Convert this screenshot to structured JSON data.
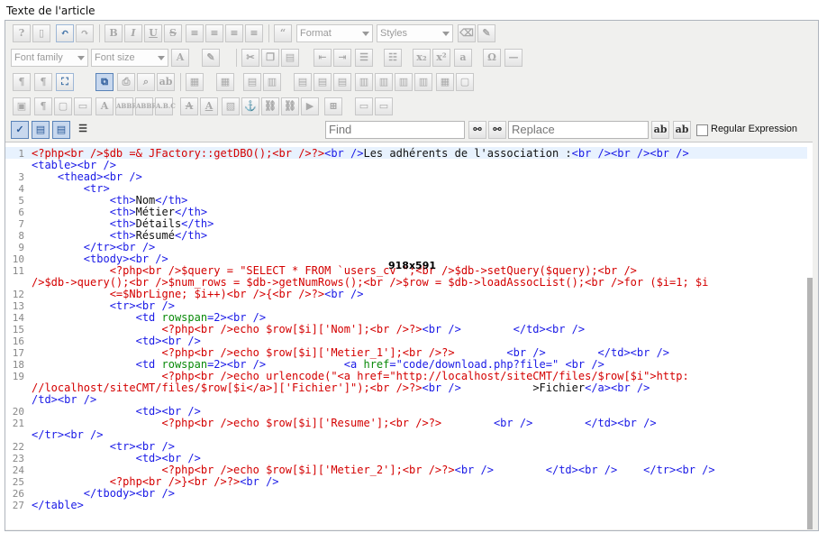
{
  "editor": {
    "title": "Texte de l'article",
    "combos": {
      "format": "Format",
      "styles": "Styles",
      "font_family": "Font family",
      "font_size": "Font size"
    },
    "find_placeholder": "Find",
    "replace_placeholder": "Replace",
    "regex_label": "Regular Expression",
    "dimension_overlay": "918x591"
  },
  "code_lines": [
    {
      "n": "1",
      "segs": [
        [
          "r",
          "<?php<br />$db =& JFactory::getDBO();<br />?>"
        ],
        [
          "b",
          "<br />"
        ],
        [
          "k",
          "Les adhérents de l'association :"
        ],
        [
          "b",
          "<br /><br /><br />"
        ]
      ]
    },
    {
      "n": "",
      "segs": [
        [
          "b",
          "<table><br />"
        ]
      ]
    },
    {
      "n": "3",
      "segs": [
        [
          "b",
          "    <thead><br />"
        ]
      ]
    },
    {
      "n": "4",
      "segs": [
        [
          "b",
          "        <tr>"
        ]
      ]
    },
    {
      "n": "5",
      "segs": [
        [
          "b",
          "            <th>"
        ],
        [
          "k",
          "Nom"
        ],
        [
          "b",
          "</th>"
        ]
      ]
    },
    {
      "n": "6",
      "segs": [
        [
          "b",
          "            <th>"
        ],
        [
          "k",
          "Métier"
        ],
        [
          "b",
          "</th>"
        ]
      ]
    },
    {
      "n": "7",
      "segs": [
        [
          "b",
          "            <th>"
        ],
        [
          "k",
          "Détails"
        ],
        [
          "b",
          "</th>"
        ]
      ]
    },
    {
      "n": "8",
      "segs": [
        [
          "b",
          "            <th>"
        ],
        [
          "k",
          "Résumé"
        ],
        [
          "b",
          "</th>"
        ]
      ]
    },
    {
      "n": "9",
      "segs": [
        [
          "b",
          "        </tr><br />"
        ]
      ]
    },
    {
      "n": "10",
      "segs": [
        [
          "b",
          "        <tbody><br />"
        ]
      ]
    },
    {
      "n": "11",
      "segs": [
        [
          "r",
          "            <?php<br />$query = \"SELECT * FROM `users_cv`\";<br />$db->setQuery($query);<br />"
        ]
      ]
    },
    {
      "n": "",
      "segs": [
        [
          "r",
          "/>$db->query();<br />$num_rows = $db->getNumRows();<br />$row = $db->loadAssocList();<br />for ($i=1; $i"
        ]
      ]
    },
    {
      "n": "12",
      "segs": [
        [
          "r",
          "            <=$NbrLigne; $i++)<br />{<br />?>"
        ],
        [
          "b",
          "<br />"
        ]
      ]
    },
    {
      "n": "13",
      "segs": [
        [
          "b",
          "            <tr><br />"
        ]
      ]
    },
    {
      "n": "14",
      "segs": [
        [
          "b",
          "                <td "
        ],
        [
          "g",
          "rowspan"
        ],
        [
          "b",
          "=2><br />"
        ]
      ]
    },
    {
      "n": "15",
      "segs": [
        [
          "r",
          "                    <?php<br />echo $row[$i]['Nom'];<br />?>"
        ],
        [
          "b",
          "<br />        </td><br />"
        ]
      ]
    },
    {
      "n": "16",
      "segs": [
        [
          "b",
          "                <td><br />"
        ]
      ]
    },
    {
      "n": "17",
      "segs": [
        [
          "r",
          "                    <?php<br />echo $row[$i]['Metier_1'];<br />?>"
        ],
        [
          "b",
          "        <br />        </td><br />"
        ]
      ]
    },
    {
      "n": "18",
      "segs": [
        [
          "b",
          "                <td "
        ],
        [
          "g",
          "rowspan"
        ],
        [
          "b",
          "=2><br />            <a "
        ],
        [
          "g",
          "href"
        ],
        [
          "b",
          "=\"code/download.php?file=\" <br />"
        ]
      ]
    },
    {
      "n": "19",
      "segs": [
        [
          "r",
          "                    <?php<br />echo urlencode(\"<a href=\"http://localhost/siteCMT/files/$row[$i\">http:"
        ]
      ]
    },
    {
      "n": "",
      "segs": [
        [
          "r",
          "//localhost/siteCMT/files/$row[$i</a>]['Fichier']\");<br />?>"
        ],
        [
          "b",
          "<br />           "
        ],
        [
          "k",
          ">Fichier"
        ],
        [
          "b",
          "</a><br />"
        ]
      ]
    },
    {
      "n": "",
      "segs": [
        [
          "b",
          "/td><br />"
        ]
      ]
    },
    {
      "n": "20",
      "segs": [
        [
          "b",
          "                <td><br />"
        ]
      ]
    },
    {
      "n": "21",
      "segs": [
        [
          "r",
          "                    <?php<br />echo $row[$i]['Resume'];<br />?>"
        ],
        [
          "b",
          "        <br />        </td><br />"
        ]
      ]
    },
    {
      "n": "",
      "segs": [
        [
          "b",
          "</tr><br />"
        ]
      ]
    },
    {
      "n": "22",
      "segs": [
        [
          "b",
          "            <tr><br />"
        ]
      ]
    },
    {
      "n": "23",
      "segs": [
        [
          "b",
          "                <td><br />"
        ]
      ]
    },
    {
      "n": "24",
      "segs": [
        [
          "r",
          "                    <?php<br />echo $row[$i]['Metier_2'];<br />?>"
        ],
        [
          "b",
          "<br />        </td><br />    </tr><br />"
        ]
      ]
    },
    {
      "n": "25",
      "segs": [
        [
          "r",
          "            <?php<br />}<br />?>"
        ],
        [
          "b",
          "<br />"
        ]
      ]
    },
    {
      "n": "26",
      "segs": [
        [
          "b",
          "        </tbody><br />"
        ]
      ]
    },
    {
      "n": "27",
      "segs": [
        [
          "b",
          "</table>"
        ]
      ]
    }
  ],
  "colors": {
    "php": "#d40000",
    "html": "#1a1ae6",
    "attr": "#0a8a0a",
    "text": "#111111"
  }
}
